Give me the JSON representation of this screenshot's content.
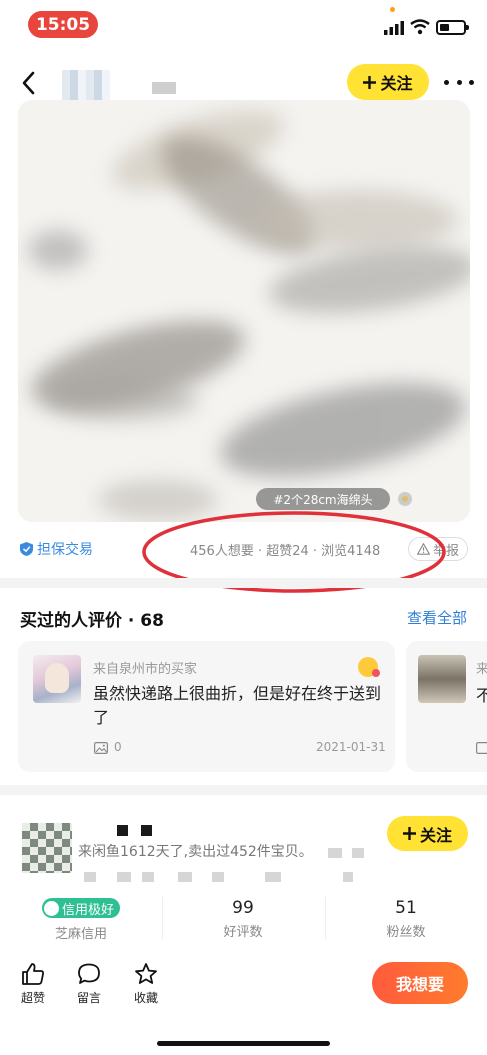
{
  "status_bar": {
    "time": "15:05"
  },
  "header": {
    "follow_label": "关注"
  },
  "product": {
    "image_tag": "#2个28cm海绵头",
    "guarantee": "担保交易",
    "stats": "456人想要 · 超赞24 · 浏览4148",
    "report": "举报"
  },
  "reviews": {
    "title": "买过的人评价 · 68",
    "view_all": "查看全部",
    "items": [
      {
        "from": "来自泉州市的买家",
        "text": "虽然快递路上很曲折，但是好在终于送到了",
        "image_count": "0",
        "date": "2021-01-31"
      },
      {
        "from": "来",
        "text": "不"
      }
    ]
  },
  "seller": {
    "description": "来闲鱼1612天了,卖出过452件宝贝。",
    "follow_label": "关注",
    "credit_badge": "信用极好",
    "credit_sub": "芝麻信用",
    "good_reviews": {
      "value": "99",
      "label": "好评数"
    },
    "fans": {
      "value": "51",
      "label": "粉丝数"
    }
  },
  "bottom_bar": {
    "like": "超赞",
    "comment": "留言",
    "favorite": "收藏",
    "want": "我想要"
  },
  "colors": {
    "accent_yellow": "#ffe233",
    "link_blue": "#2f7fd6",
    "want_orange": "#ff5b3d",
    "annotation_red": "#e0303a",
    "credit_green": "#2ec093"
  }
}
